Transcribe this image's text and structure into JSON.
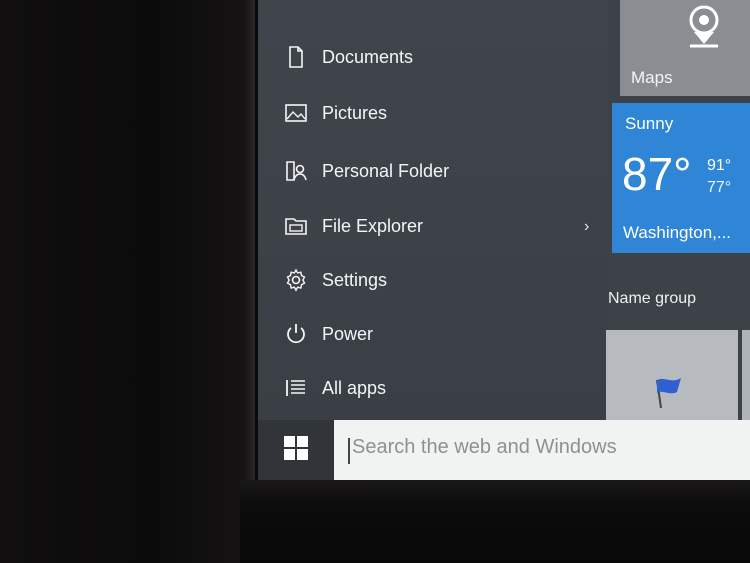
{
  "start_menu": {
    "items": [
      {
        "label": "Documents",
        "icon": "document-icon"
      },
      {
        "label": "Pictures",
        "icon": "pictures-icon"
      },
      {
        "label": "Personal Folder",
        "icon": "person-folder-icon"
      },
      {
        "label": "File Explorer",
        "icon": "folder-icon",
        "has_submenu": true
      },
      {
        "label": "Settings",
        "icon": "gear-icon"
      },
      {
        "label": "Power",
        "icon": "power-icon"
      },
      {
        "label": "All apps",
        "icon": "list-icon"
      }
    ],
    "submenu_chevron": "›"
  },
  "tiles": {
    "maps": {
      "label": "Maps",
      "icon": "map-pin-icon"
    },
    "weather": {
      "condition": "Sunny",
      "temperature": "87°",
      "high": "91°",
      "low": "77°",
      "location": "Washington,..."
    },
    "group_name": "Name group"
  },
  "taskbar": {
    "search_placeholder": "Search the web and Windows"
  },
  "colors": {
    "weather_tile": "#2f86d6",
    "menu_bg": "#3d4249",
    "search_bg": "#f1f2f2"
  }
}
